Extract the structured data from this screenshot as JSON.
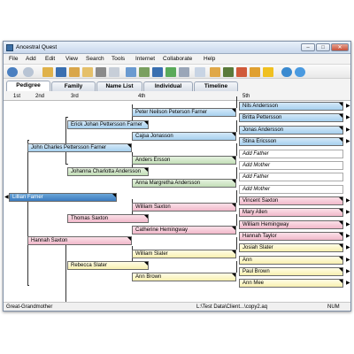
{
  "window": {
    "title": "Ancestral Quest"
  },
  "menu": [
    "File",
    "Add",
    "Edit",
    "View",
    "Search",
    "Tools",
    "Internet",
    "Collaborate",
    "Help"
  ],
  "tabs": [
    "Pedigree",
    "Family",
    "Name List",
    "Individual",
    "Timeline"
  ],
  "generations": [
    "1st",
    "2nd",
    "3rd",
    "4th",
    "5th"
  ],
  "people": {
    "p1": "Lillian Farner",
    "p2": "John Charles Pettersson Farner",
    "p3": "Hannah Saxton",
    "p4": "Erick Johan Pettersson Farner",
    "p5": "Johanna Charlotta Andersson",
    "p6": "Thomas Saxton",
    "p7": "Rebecca Slater",
    "p8": "Peter Neilson Peterson Farner",
    "p9": "Cajsa Jonasson",
    "p10": "Anders Ersson",
    "p11": "Anna Margretha Andersson",
    "p12": "William Saxton",
    "p13": "Catherine Hemingway",
    "p14": "William Slater",
    "p15": "Ann Brown",
    "g5": [
      "Nils Andersson",
      "Britta Pettersson",
      "Jonas Andersson",
      "Stina Ericsson",
      "Add Father",
      "Add Mother",
      "Add Father",
      "Add Mother",
      "Vincent Saxton",
      "Mary Allen",
      "William Hemingway",
      "Hannah Taylor",
      "Josiah Slater",
      "Ann",
      "Paul Brown",
      "Ann Mee"
    ]
  },
  "status": {
    "left": "Great-Grandmother",
    "path": "L:\\Test Data\\Client...\\copy2.aq",
    "mode": "NUM"
  },
  "colors": {
    "paternal": "#a7d0ef",
    "maternal_green": "#c3dfb8",
    "pink": "#f1b9ca",
    "yellow": "#f8f0b0",
    "selected": "#3b7bbf"
  }
}
